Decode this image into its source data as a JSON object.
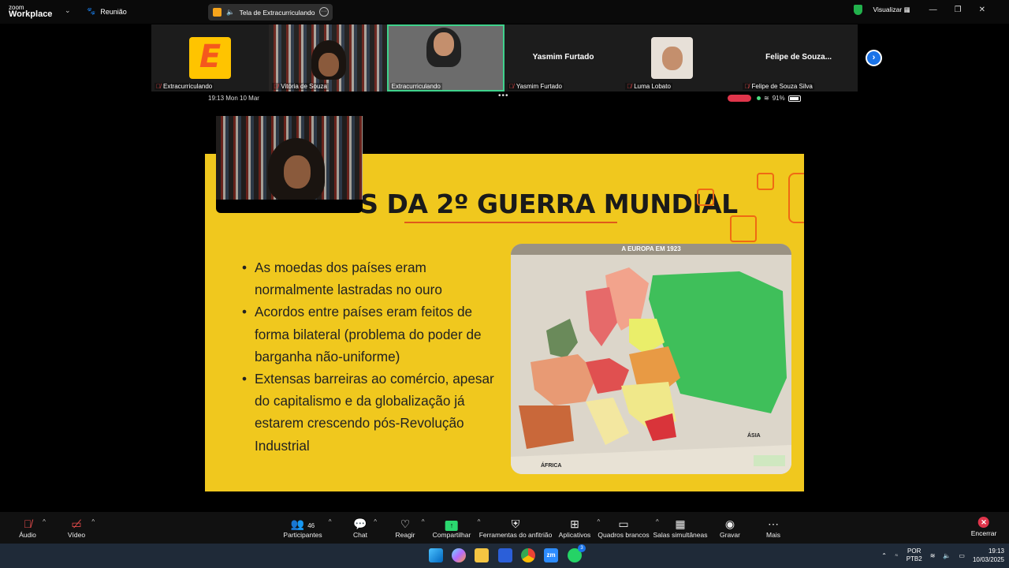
{
  "app": {
    "zoom_small": "zoom",
    "zoom_brand": "Workplace",
    "meeting_label": "Reunião"
  },
  "share_pill": {
    "label": "Tela de Extracurriculando"
  },
  "top_right": {
    "view_label": "Visualizar"
  },
  "participants": [
    {
      "name": "Extracurriculando",
      "big": ""
    },
    {
      "name": "Vitória de Souza",
      "big": ""
    },
    {
      "name": "Extracurriculando",
      "big": ""
    },
    {
      "name": "Yasmim Furtado",
      "big": "Yasmim Furtado"
    },
    {
      "name": "Luma Lobato",
      "big": ""
    },
    {
      "name": "Felipe de Souza Silva",
      "big": "Felipe de Souza..."
    }
  ],
  "shared_status": {
    "time": "19:13  Mon 10 Mar",
    "battery": "91%"
  },
  "slide": {
    "title": "ANTES DA 2º GUERRA MUNDIAL",
    "bullets": [
      "As moedas dos países eram normalmente lastradas no ouro",
      "Acordos entre países eram feitos de forma bilateral (problema do poder de barganha não-uniforme)",
      "Extensas barreiras ao comércio, apesar do capitalismo e da globalização já estarem crescendo pós-Revolução Industrial"
    ],
    "map_title": "A EUROPA EM 1923",
    "map_labels": {
      "africa": "ÁFRICA",
      "asia": "ÁSIA"
    }
  },
  "toolbar": {
    "audio": "Áudio",
    "video": "Vídeo",
    "participants": "Participantes",
    "participants_count": "46",
    "chat": "Chat",
    "react": "Reagir",
    "share": "Compartilhar",
    "host_tools": "Ferramentas do anfitrião",
    "apps": "Aplicativos",
    "whiteboards": "Quadros brancos",
    "breakout": "Salas simultâneas",
    "record": "Gravar",
    "more": "Mais",
    "end": "Encerrar"
  },
  "taskbar": {
    "lang1": "POR",
    "lang2": "PTB2",
    "time": "19:13",
    "date": "10/03/2025",
    "whatsapp_badge": "3"
  },
  "colors": {
    "slide_bg": "#f0c81e",
    "accent_orange": "#ef6a13",
    "active_green": "#3fd28c",
    "end_red": "#e0354b"
  }
}
